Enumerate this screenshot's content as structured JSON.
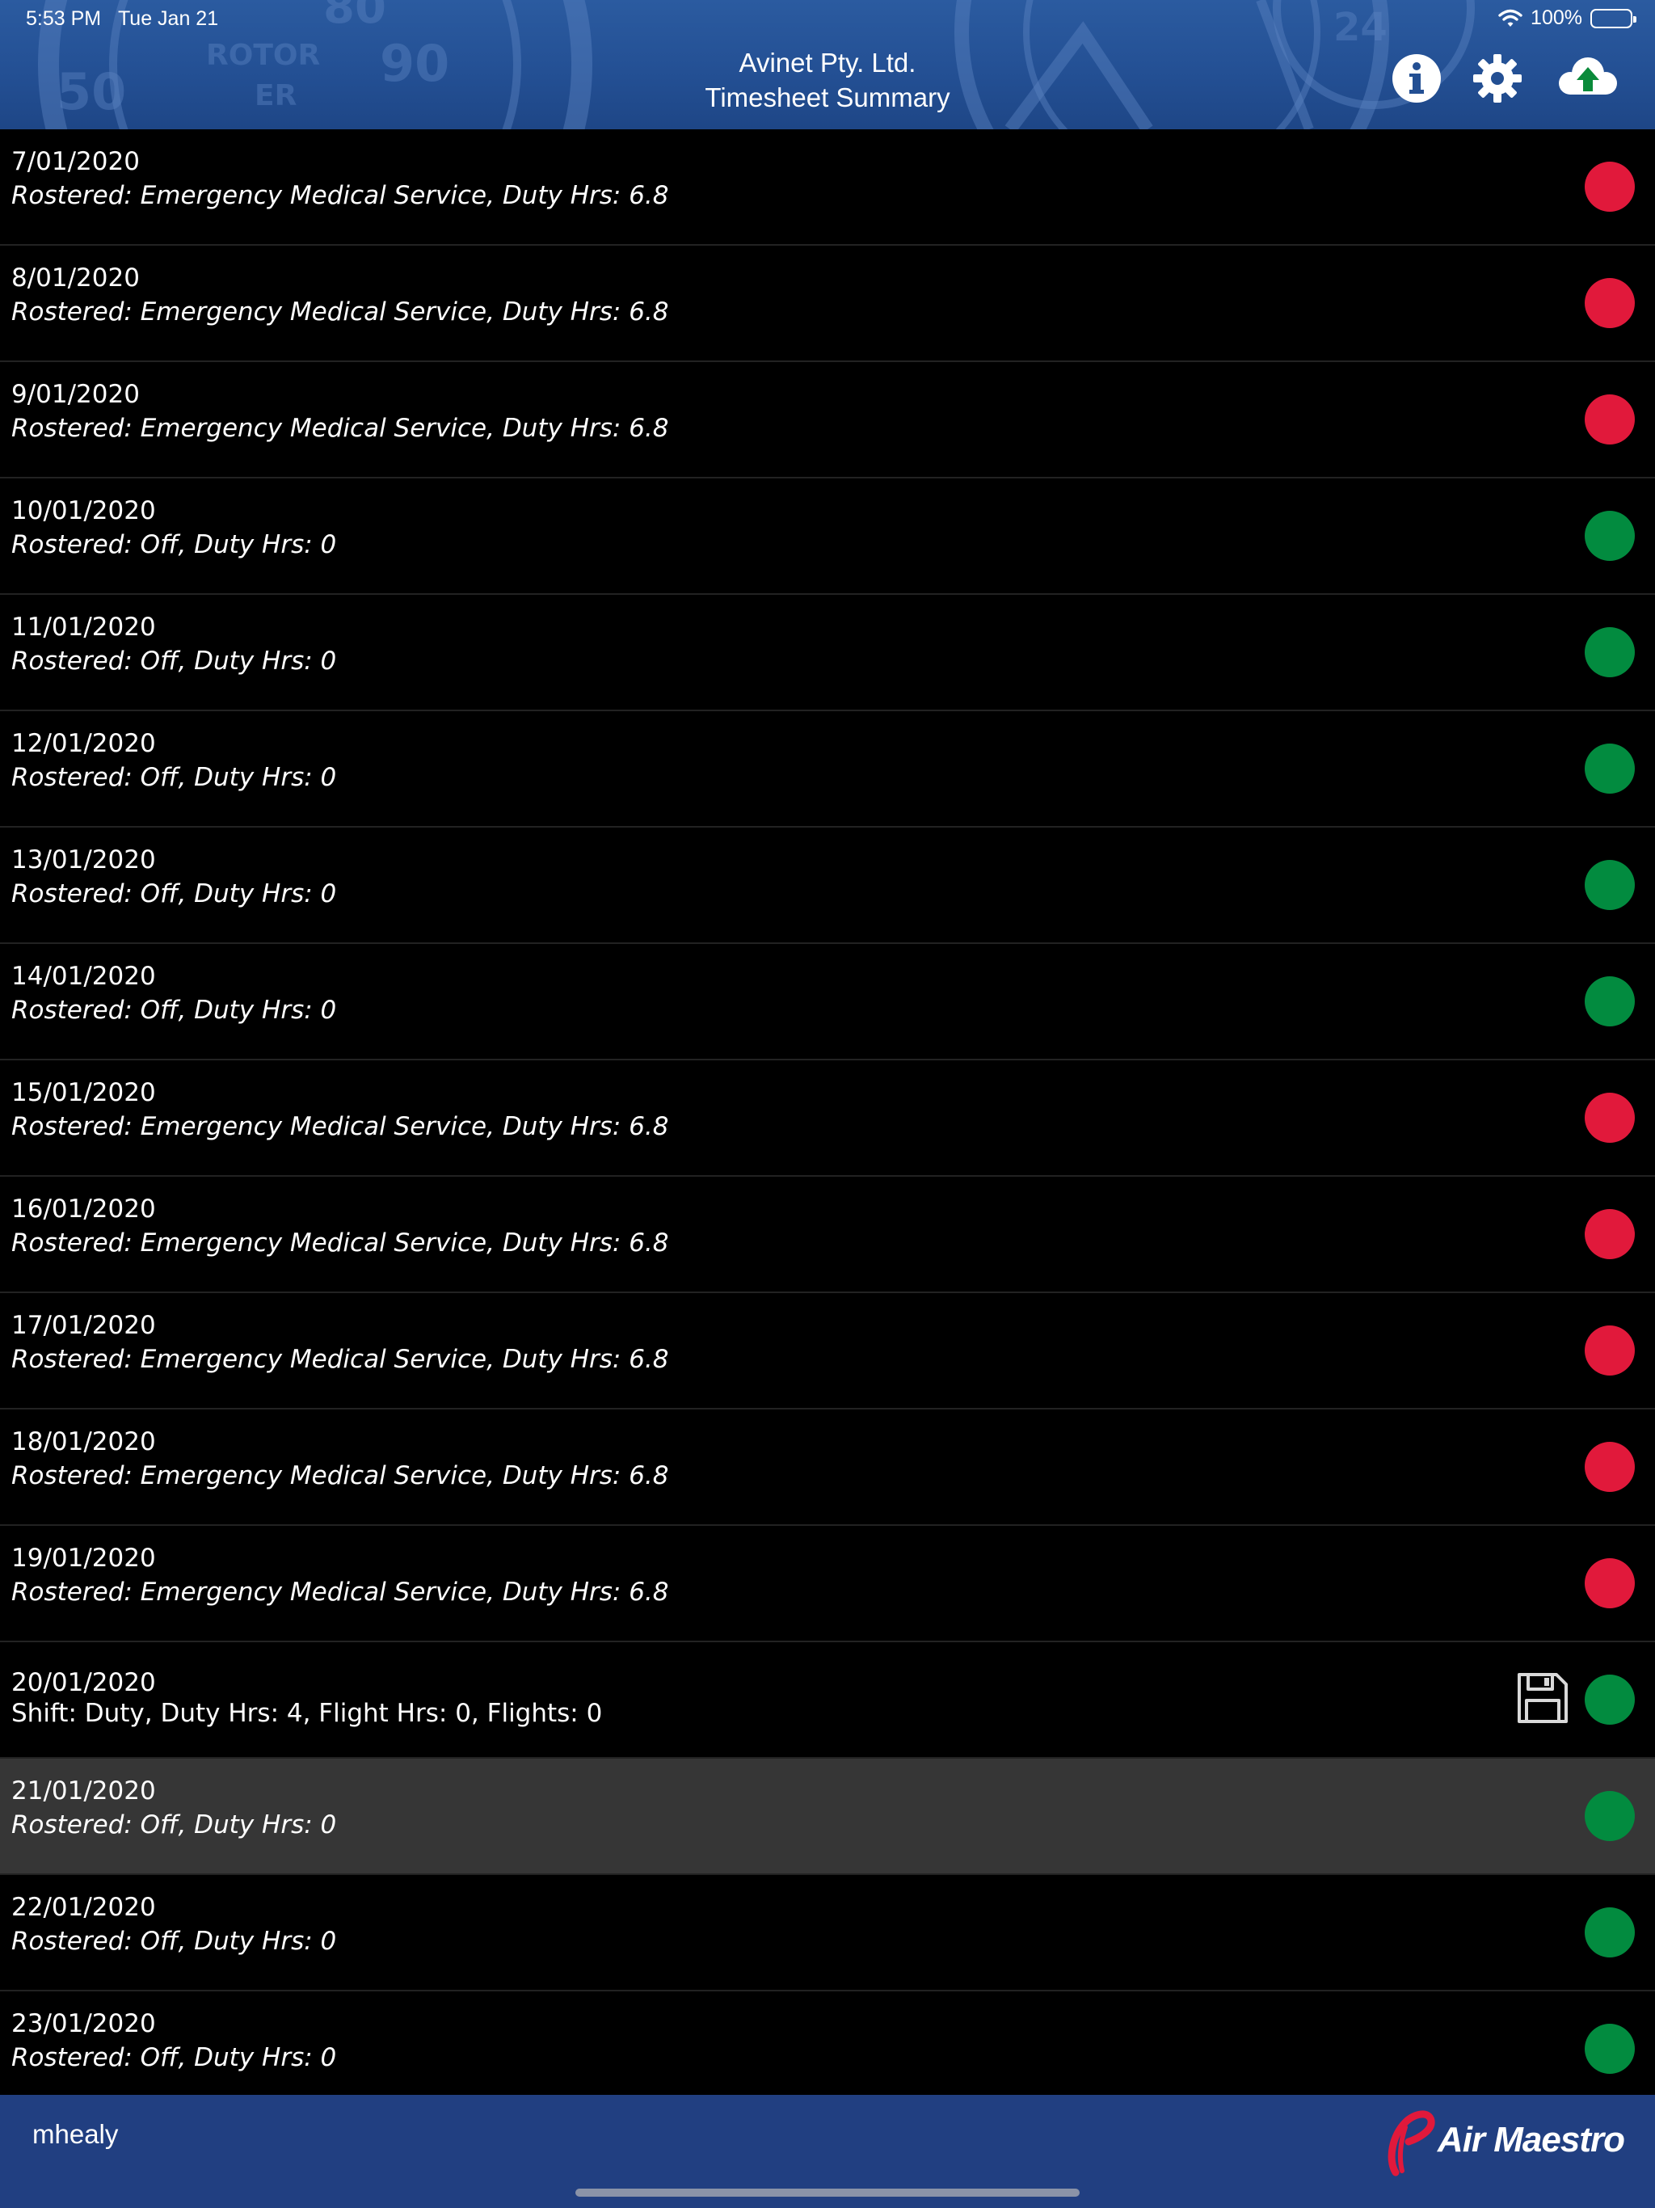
{
  "status_bar": {
    "time": "5:53 PM",
    "date": "Tue Jan 21",
    "battery": "100%"
  },
  "header": {
    "company": "Avinet Pty. Ltd.",
    "title": "Timesheet Summary",
    "buttons": [
      "info-icon",
      "gear-icon",
      "cloud-upload-icon"
    ]
  },
  "rows": [
    {
      "date": "7/01/2020",
      "detail": "Rostered: Emergency Medical Service, Duty Hrs: 6.8",
      "status": "red"
    },
    {
      "date": "8/01/2020",
      "detail": "Rostered: Emergency Medical Service, Duty Hrs: 6.8",
      "status": "red"
    },
    {
      "date": "9/01/2020",
      "detail": "Rostered: Emergency Medical Service, Duty Hrs: 6.8",
      "status": "red"
    },
    {
      "date": "10/01/2020",
      "detail": "Rostered: Off, Duty Hrs: 0",
      "status": "green"
    },
    {
      "date": "11/01/2020",
      "detail": "Rostered: Off, Duty Hrs: 0",
      "status": "green"
    },
    {
      "date": "12/01/2020",
      "detail": "Rostered: Off, Duty Hrs: 0",
      "status": "green"
    },
    {
      "date": "13/01/2020",
      "detail": "Rostered: Off, Duty Hrs: 0",
      "status": "green"
    },
    {
      "date": "14/01/2020",
      "detail": "Rostered: Off, Duty Hrs: 0",
      "status": "green"
    },
    {
      "date": "15/01/2020",
      "detail": "Rostered: Emergency Medical Service, Duty Hrs: 6.8",
      "status": "red"
    },
    {
      "date": "16/01/2020",
      "detail": "Rostered: Emergency Medical Service, Duty Hrs: 6.8",
      "status": "red"
    },
    {
      "date": "17/01/2020",
      "detail": "Rostered: Emergency Medical Service, Duty Hrs: 6.8",
      "status": "red"
    },
    {
      "date": "18/01/2020",
      "detail": "Rostered: Emergency Medical Service, Duty Hrs: 6.8",
      "status": "red"
    },
    {
      "date": "19/01/2020",
      "detail": "Rostered: Emergency Medical Service, Duty Hrs: 6.8",
      "status": "red"
    },
    {
      "date": "20/01/2020",
      "detail": "Shift: Duty, Duty Hrs: 4, Flight Hrs: 0, Flights: 0",
      "status": "green",
      "saved": true
    },
    {
      "date": "21/01/2020",
      "detail": "Rostered: Off, Duty Hrs: 0",
      "status": "green",
      "selected": true
    },
    {
      "date": "22/01/2020",
      "detail": "Rostered: Off, Duty Hrs: 0",
      "status": "green"
    },
    {
      "date": "23/01/2020",
      "detail": "Rostered: Off, Duty Hrs: 0",
      "status": "green"
    }
  ],
  "footer": {
    "username": "mhealy",
    "logo_text": "Air Maestro"
  },
  "colors": {
    "header_blue": "#2b5ba0",
    "footer_blue": "#213f81",
    "status_red": "#e1193b",
    "status_green": "#028b3f",
    "selected_row": "#363636",
    "upload_arrow": "#0a8a3a",
    "logo_red": "#e1193b"
  }
}
